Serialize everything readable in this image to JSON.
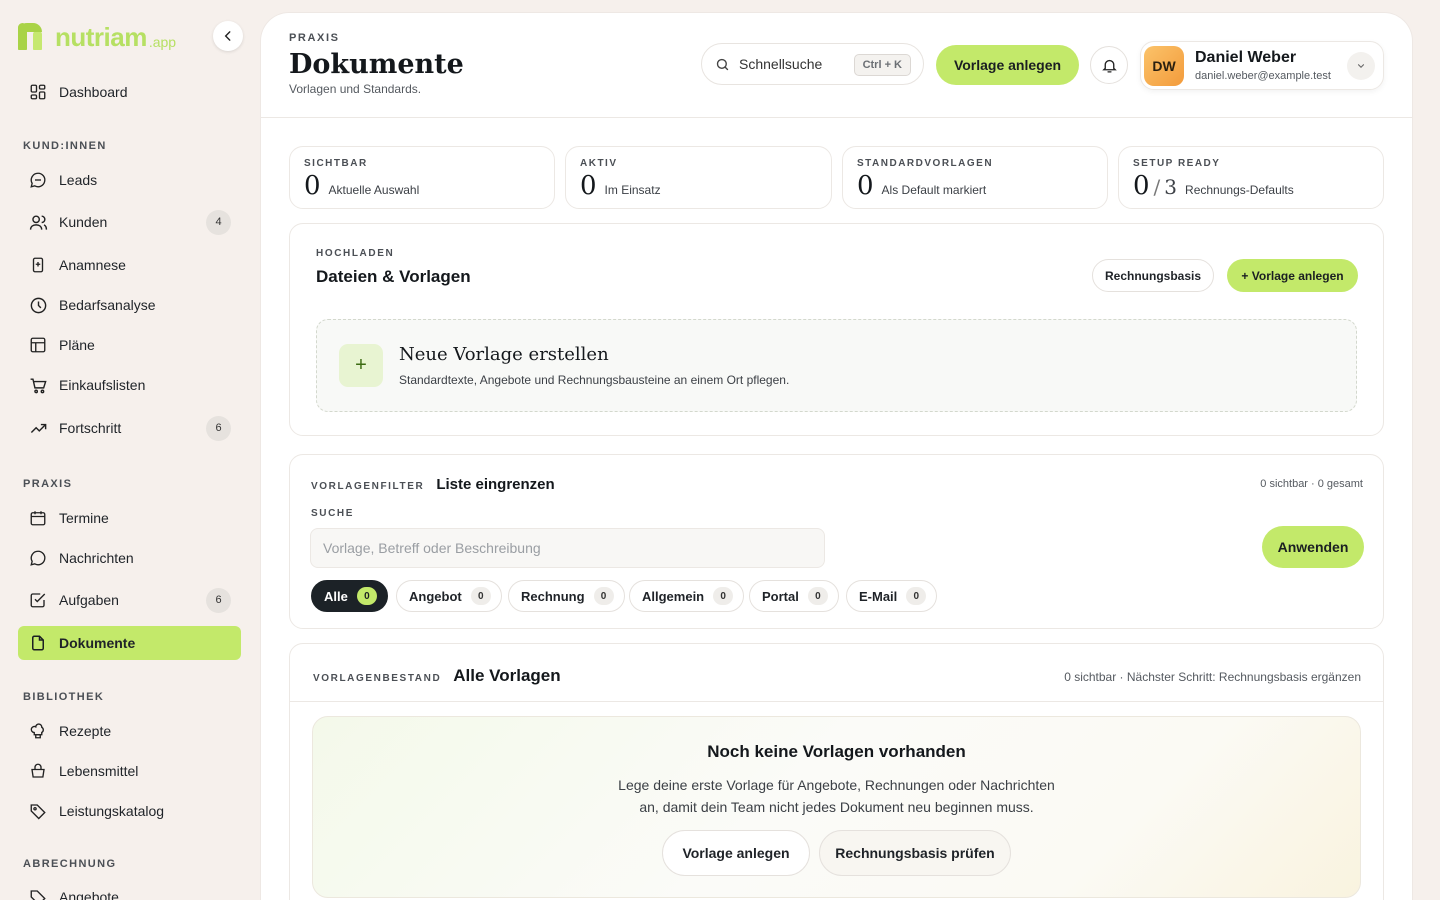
{
  "brand": {
    "word": "nutriam",
    "suffix": ".app"
  },
  "sidebar": {
    "sections": {
      "clients": "KUND:INNEN",
      "practice": "PRAXIS",
      "library": "BIBLIOTHEK",
      "billing": "ABRECHNUNG"
    },
    "items": [
      {
        "label": "Dashboard",
        "icon": "dashboard-icon"
      },
      {
        "label": "Leads",
        "icon": "chat-icon"
      },
      {
        "label": "Kunden",
        "icon": "users-icon",
        "badge": "4"
      },
      {
        "label": "Anamnese",
        "icon": "clipboard-icon"
      },
      {
        "label": "Bedarfsanalyse",
        "icon": "clock-icon"
      },
      {
        "label": "Pläne",
        "icon": "table-icon"
      },
      {
        "label": "Einkaufslisten",
        "icon": "cart-icon"
      },
      {
        "label": "Fortschritt",
        "icon": "trend-icon",
        "badge": "6"
      },
      {
        "label": "Termine",
        "icon": "calendar-icon"
      },
      {
        "label": "Nachrichten",
        "icon": "message-icon"
      },
      {
        "label": "Aufgaben",
        "icon": "checkbox-icon",
        "badge": "6"
      },
      {
        "label": "Dokumente",
        "icon": "document-icon",
        "active": true
      },
      {
        "label": "Rezepte",
        "icon": "chef-hat-icon"
      },
      {
        "label": "Lebensmittel",
        "icon": "basket-icon"
      },
      {
        "label": "Leistungskatalog",
        "icon": "tag-icon"
      },
      {
        "label": "Angebote",
        "icon": "offer-icon"
      }
    ]
  },
  "header": {
    "eyebrow": "PRAXIS",
    "title": "Dokumente",
    "subtitle": "Vorlagen und Standards.",
    "search_label": "Schnellsuche",
    "search_shortcut": "Ctrl + K",
    "primary_button": "Vorlage anlegen",
    "user": {
      "initials": "DW",
      "name": "Daniel Weber",
      "email": "daniel.weber@example.test"
    }
  },
  "stats": [
    {
      "eyebrow": "SICHTBAR",
      "value": "0",
      "label": "Aktuelle Auswahl"
    },
    {
      "eyebrow": "AKTIV",
      "value": "0",
      "label": "Im Einsatz"
    },
    {
      "eyebrow": "STANDARDVORLAGEN",
      "value": "0",
      "label": "Als Default markiert"
    },
    {
      "eyebrow": "SETUP READY",
      "value": "0",
      "of": "3",
      "label": "Rechnungs-Defaults"
    }
  ],
  "upload": {
    "eyebrow": "HOCHLADEN",
    "title": "Dateien & Vorlagen",
    "secondary_button": "Rechnungsbasis",
    "primary_button": "+ Vorlage anlegen",
    "dropzone_title": "Neue Vorlage erstellen",
    "dropzone_text": "Standardtexte, Angebote und Rechnungsbausteine an einem Ort pflegen.",
    "dropzone_plus": "+"
  },
  "filter": {
    "eyebrow": "VORLAGENFILTER",
    "title": "Liste eingrenzen",
    "meta": "0 sichtbar · 0 gesamt",
    "search_label": "SUCHE",
    "search_placeholder": "Vorlage, Betreff oder Beschreibung",
    "apply_button": "Anwenden",
    "chips": [
      {
        "label": "Alle",
        "count": "0"
      },
      {
        "label": "Angebot",
        "count": "0"
      },
      {
        "label": "Rechnung",
        "count": "0"
      },
      {
        "label": "Allgemein",
        "count": "0"
      },
      {
        "label": "Portal",
        "count": "0"
      },
      {
        "label": "E-Mail",
        "count": "0"
      }
    ]
  },
  "inventory": {
    "eyebrow": "VORLAGENBESTAND",
    "title": "Alle Vorlagen",
    "meta": "0 sichtbar · Nächster Schritt: Rechnungsbasis ergänzen",
    "empty_title": "Noch keine Vorlagen vorhanden",
    "empty_line1": "Lege deine erste Vorlage für Angebote, Rechnungen oder Nachrichten",
    "empty_line2": "an, damit dein Team nicht jedes Dokument neu beginnen muss.",
    "button_create": "Vorlage anlegen",
    "button_check": "Rechnungsbasis prüfen"
  }
}
